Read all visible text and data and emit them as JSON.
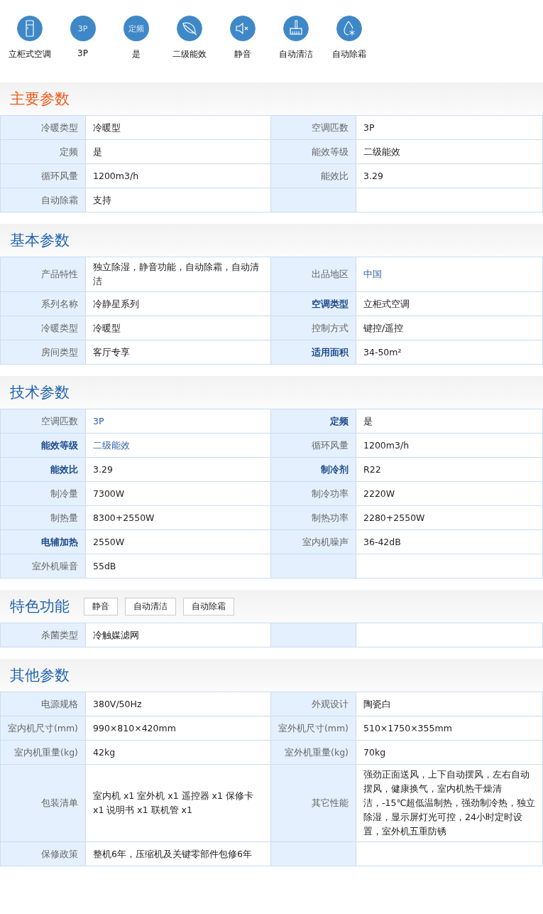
{
  "features": [
    {
      "kind": "cabinet",
      "caption": "立柜式空调"
    },
    {
      "kind": "text",
      "glyph": "3P",
      "caption": "3P"
    },
    {
      "kind": "text",
      "glyph": "定频",
      "caption": "是"
    },
    {
      "kind": "leaf",
      "caption": "二级能效"
    },
    {
      "kind": "mute",
      "caption": "静音"
    },
    {
      "kind": "brush",
      "caption": "自动清洁"
    },
    {
      "kind": "droplet",
      "caption": "自动除霜"
    }
  ],
  "sections": [
    {
      "title": "主要参数",
      "highlighted": true,
      "rows": [
        {
          "pairs": [
            {
              "label": "冷暖类型",
              "emphasized": false,
              "value": "冷暖型",
              "linked": false
            },
            {
              "label": "空调匹数",
              "emphasized": false,
              "value": "3P",
              "linked": false
            }
          ]
        },
        {
          "pairs": [
            {
              "label": "定频",
              "emphasized": false,
              "value": "是",
              "linked": false
            },
            {
              "label": "能效等级",
              "emphasized": false,
              "value": "二级能效",
              "linked": false
            }
          ]
        },
        {
          "pairs": [
            {
              "label": "循环风量",
              "emphasized": false,
              "value": "1200m3/h",
              "linked": false
            },
            {
              "label": "能效比",
              "emphasized": false,
              "value": "3.29",
              "linked": false
            }
          ]
        },
        {
          "pairs": [
            {
              "label": "自动除霜",
              "emphasized": false,
              "value": "支持",
              "linked": false
            }
          ]
        }
      ]
    },
    {
      "title": "基本参数",
      "highlighted": false,
      "rows": [
        {
          "pairs": [
            {
              "label": "产品特性",
              "emphasized": false,
              "value": "独立除湿，静音功能，自动除霜，自动清洁",
              "linked": false
            },
            {
              "label": "出品地区",
              "emphasized": false,
              "value": "中国",
              "linked": true
            }
          ]
        },
        {
          "pairs": [
            {
              "label": "系列名称",
              "emphasized": false,
              "value": "冷静星系列",
              "linked": false
            },
            {
              "label": "空调类型",
              "emphasized": true,
              "value": "立柜式空调",
              "linked": false
            }
          ]
        },
        {
          "pairs": [
            {
              "label": "冷暖类型",
              "emphasized": false,
              "value": "冷暖型",
              "linked": false
            },
            {
              "label": "控制方式",
              "emphasized": false,
              "value": "键控/遥控",
              "linked": false
            }
          ]
        },
        {
          "pairs": [
            {
              "label": "房间类型",
              "emphasized": false,
              "value": "客厅专享",
              "linked": false
            },
            {
              "label": "适用面积",
              "emphasized": true,
              "value": "34-50m²",
              "linked": false
            }
          ]
        }
      ]
    },
    {
      "title": "技术参数",
      "highlighted": false,
      "rows": [
        {
          "pairs": [
            {
              "label": "空调匹数",
              "emphasized": false,
              "value": "3P",
              "linked": true
            },
            {
              "label": "定频",
              "emphasized": true,
              "value": "是",
              "linked": false
            }
          ]
        },
        {
          "pairs": [
            {
              "label": "能效等级",
              "emphasized": true,
              "value": "二级能效",
              "linked": true
            },
            {
              "label": "循环风量",
              "emphasized": false,
              "value": "1200m3/h",
              "linked": false
            }
          ]
        },
        {
          "pairs": [
            {
              "label": "能效比",
              "emphasized": true,
              "value": "3.29",
              "linked": false
            },
            {
              "label": "制冷剂",
              "emphasized": true,
              "value": "R22",
              "linked": false
            }
          ]
        },
        {
          "pairs": [
            {
              "label": "制冷量",
              "emphasized": false,
              "value": "7300W",
              "linked": false
            },
            {
              "label": "制冷功率",
              "emphasized": false,
              "value": "2220W",
              "linked": false
            }
          ]
        },
        {
          "pairs": [
            {
              "label": "制热量",
              "emphasized": false,
              "value": "8300+2550W",
              "linked": false
            },
            {
              "label": "制热功率",
              "emphasized": false,
              "value": "2280+2550W",
              "linked": false
            }
          ]
        },
        {
          "pairs": [
            {
              "label": "电辅加热",
              "emphasized": true,
              "value": "2550W",
              "linked": false
            },
            {
              "label": "室内机噪声",
              "emphasized": false,
              "value": "36-42dB",
              "linked": false
            }
          ]
        },
        {
          "pairs": [
            {
              "label": "室外机噪音",
              "emphasized": false,
              "value": "55dB",
              "linked": false
            }
          ]
        }
      ]
    },
    {
      "title": "特色功能",
      "highlighted": false,
      "tags": [
        "静音",
        "自动清洁",
        "自动除霜"
      ],
      "rows": [
        {
          "pairs": [
            {
              "label": "杀菌类型",
              "emphasized": false,
              "value": "冷触媒滤网",
              "linked": false
            }
          ]
        }
      ]
    },
    {
      "title": "其他参数",
      "highlighted": false,
      "rows": [
        {
          "pairs": [
            {
              "label": "电源规格",
              "emphasized": false,
              "value": "380V/50Hz",
              "linked": false
            },
            {
              "label": "外观设计",
              "emphasized": false,
              "value": "陶瓷白",
              "linked": false
            }
          ]
        },
        {
          "pairs": [
            {
              "label": "室内机尺寸(mm)",
              "emphasized": false,
              "value": "990×810×420mm",
              "linked": false
            },
            {
              "label": "室外机尺寸(mm)",
              "emphasized": false,
              "value": "510×1750×355mm",
              "linked": false
            }
          ]
        },
        {
          "pairs": [
            {
              "label": "室内机重量(kg)",
              "emphasized": false,
              "value": "42kg",
              "linked": false
            },
            {
              "label": "室外机重量(kg)",
              "emphasized": false,
              "value": "70kg",
              "linked": false
            }
          ]
        },
        {
          "pairs": [
            {
              "label": "包装清单",
              "emphasized": false,
              "value": "室内机 x1 室外机 x1 遥控器 x1 保修卡 x1 说明书 x1 联机管 x1",
              "linked": false
            },
            {
              "label": "其它性能",
              "emphasized": false,
              "value": "强劲正面送风，上下自动摆风，左右自动摆风，健康换气，室内机热干燥清洁，-15℃超低温制热，强劲制冷热，独立除湿，显示屏灯光可控，24小时定时设置，室外机五重防锈",
              "linked": false
            }
          ]
        },
        {
          "pairs": [
            {
              "label": "保修政策",
              "emphasized": false,
              "value": "整机6年，压缩机及关键零部件包修6年",
              "linked": false
            }
          ]
        }
      ]
    }
  ]
}
